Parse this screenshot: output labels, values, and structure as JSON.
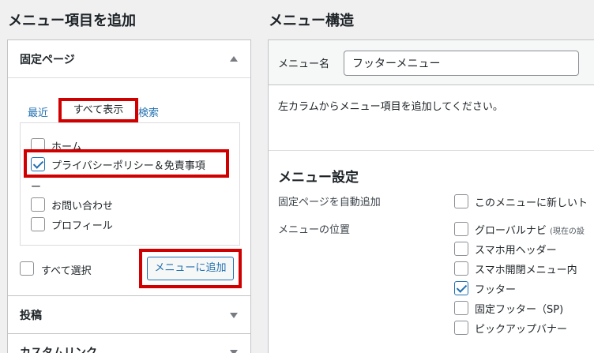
{
  "left": {
    "heading": "メニュー項目を追加",
    "pages_section": {
      "title": "固定ページ",
      "tabs": [
        "最近",
        "すべて表示",
        "検索"
      ],
      "items": [
        {
          "label": "ホーム",
          "checked": false
        },
        {
          "label": "プライバシーポリシー＆免責事項",
          "checked": true
        },
        {
          "label": "ー",
          "checked": false
        },
        {
          "label": "お問い合わせ",
          "checked": false
        },
        {
          "label": "プロフィール",
          "checked": false
        }
      ],
      "select_all": "すべて選択",
      "add_button": "メニューに追加"
    },
    "sections": [
      "投稿",
      "カスタムリンク"
    ]
  },
  "right": {
    "heading": "メニュー構造",
    "name_label": "メニュー名",
    "name_value": "フッターメニュー",
    "instruction": "左カラムからメニュー項目を追加してください。",
    "settings_heading": "メニュー設定",
    "auto_add_label": "固定ページを自動追加",
    "auto_add_option": "このメニューに新しいト",
    "location_label": "メニューの位置",
    "locations": [
      {
        "label": "グローバルナビ",
        "note": "(現在の設",
        "checked": false
      },
      {
        "label": "スマホ用ヘッダー",
        "note": "",
        "checked": false
      },
      {
        "label": "スマホ開閉メニュー内",
        "note": "",
        "checked": false
      },
      {
        "label": "フッター",
        "note": "",
        "checked": true
      },
      {
        "label": "固定フッター（SP)",
        "note": "",
        "checked": false
      },
      {
        "label": "ピックアップバナー",
        "note": "",
        "checked": false
      }
    ]
  },
  "colors": {
    "highlight": "#d10000",
    "link": "#2271b1"
  }
}
